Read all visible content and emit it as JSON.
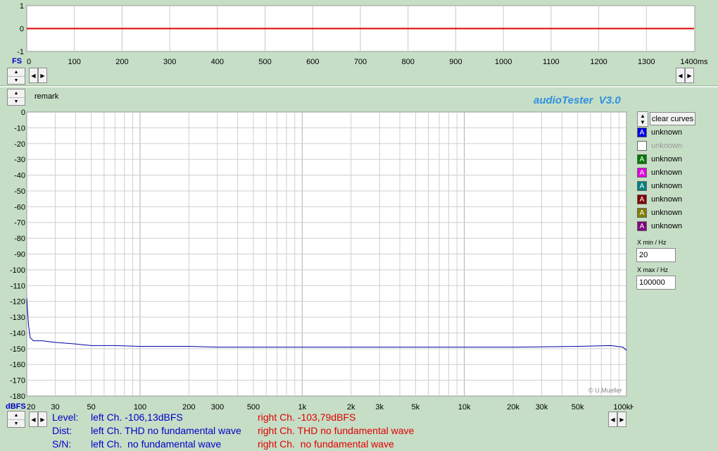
{
  "top_chart": {
    "y_ticks": [
      "1",
      "0",
      "-1"
    ],
    "x_ticks": [
      "0",
      "100",
      "200",
      "300",
      "400",
      "500",
      "600",
      "700",
      "800",
      "900",
      "1000",
      "1100",
      "1200",
      "1300",
      "1400ms"
    ],
    "unit_label": "FS",
    "trace_color": "#e00000"
  },
  "remark_label": "remark",
  "title": "audioTester  V3.0",
  "main_chart": {
    "y_ticks": [
      "0",
      "-10",
      "-20",
      "-30",
      "-40",
      "-50",
      "-60",
      "-70",
      "-80",
      "-90",
      "-100",
      "-110",
      "-120",
      "-130",
      "-140",
      "-150",
      "-160",
      "-170",
      "-180"
    ],
    "x_ticks": [
      "20",
      "30",
      "50",
      "100",
      "200",
      "300",
      "500",
      "1k",
      "2k",
      "3k",
      "5k",
      "10k",
      "20k",
      "30k",
      "50k",
      "100kHz"
    ],
    "y_unit_label": "dBFS",
    "copyright": "© U.Mueller",
    "trace_color": "#0000a8"
  },
  "chart_data": {
    "type": "line",
    "title": "",
    "xlabel": "Hz",
    "ylabel": "dBFS",
    "x_scale": "log",
    "xlim": [
      20,
      100000
    ],
    "ylim": [
      -180,
      0
    ],
    "grid": true,
    "series": [
      {
        "x": [
          20,
          20.5,
          21,
          22,
          25,
          30,
          40,
          50,
          70,
          100,
          200,
          300,
          500,
          1000,
          2000,
          5000,
          10000,
          20000,
          50000,
          80000,
          95000,
          100000
        ],
        "y": [
          -118,
          -135,
          -143,
          -145,
          -145,
          -146,
          -147,
          -148,
          -148,
          -148.5,
          -148.5,
          -149,
          -149,
          -149,
          -149,
          -149,
          -149,
          -149,
          -148.5,
          -148,
          -149,
          -151
        ]
      }
    ]
  },
  "controls": {
    "clear_curves": "clear curves",
    "legend": [
      {
        "label": "unknown",
        "color": "#0000e0",
        "glyph": "A",
        "dim": false
      },
      {
        "label": "unknown",
        "color": "#ffffff",
        "glyph": "",
        "dim": true
      },
      {
        "label": "unknown",
        "color": "#007a00",
        "glyph": "A",
        "dim": false
      },
      {
        "label": "unknown",
        "color": "#e000e0",
        "glyph": "A",
        "dim": false
      },
      {
        "label": "unknown",
        "color": "#008080",
        "glyph": "A",
        "dim": false
      },
      {
        "label": "unknown",
        "color": "#800000",
        "glyph": "A",
        "dim": false
      },
      {
        "label": "unknown",
        "color": "#808000",
        "glyph": "A",
        "dim": false
      },
      {
        "label": "unknown",
        "color": "#800080",
        "glyph": "A",
        "dim": false
      }
    ],
    "xmin_label": "X min / Hz",
    "xmin_value": "20",
    "xmax_label": "X max / Hz",
    "xmax_value": "100000"
  },
  "stats": {
    "level_label": "Level:",
    "level_left": "left Ch. -106,13dBFS",
    "level_right": "right Ch. -103,79dBFS",
    "dist_label": "Dist:",
    "dist_left": "left Ch. THD no fundamental wave",
    "dist_right": "right Ch. THD no fundamental wave",
    "sn_label": "S/N:",
    "sn_left": "left Ch.  no fundamental wave",
    "sn_right": "right Ch.  no fundamental wave"
  }
}
